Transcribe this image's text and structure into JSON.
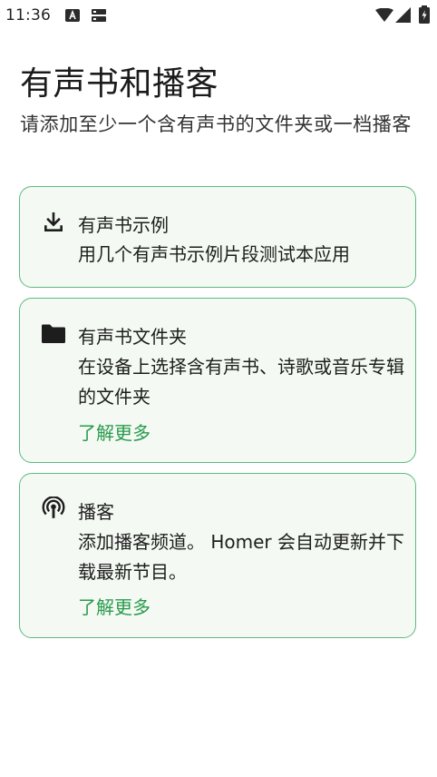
{
  "status_bar": {
    "time": "11:36"
  },
  "page": {
    "title": "有声书和播客",
    "subtitle": "请添加至少一个含有声书的文件夹或一档播客"
  },
  "cards": [
    {
      "icon": "download-icon",
      "title": "有声书示例",
      "description": "用几个有声书示例片段测试本应用"
    },
    {
      "icon": "folder-icon",
      "title": "有声书文件夹",
      "description": "在设备上选择含有声书、诗歌或音乐专辑的文件夹",
      "link": "了解更多"
    },
    {
      "icon": "podcast-icon",
      "title": "播客",
      "description": "添加播客频道。 Homer 会自动更新并下载最新节目。",
      "link": "了解更多"
    }
  ],
  "colors": {
    "accent": "#2a9a4d",
    "card_border": "#5fb97f",
    "card_background": "#f4faf3"
  }
}
